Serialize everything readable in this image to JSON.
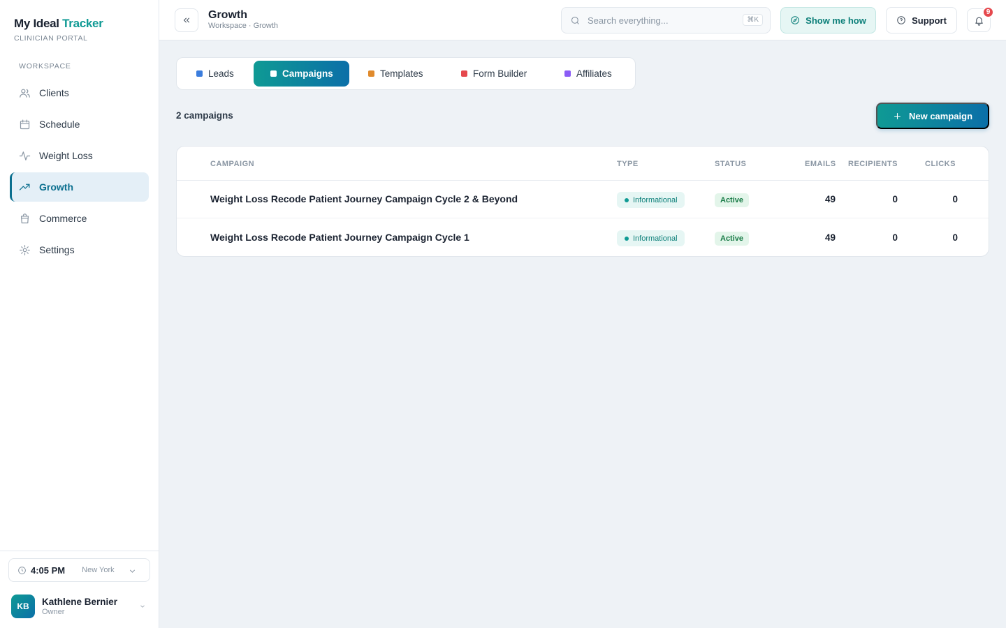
{
  "brand": {
    "name_part1": "My Ideal",
    "name_part2": "Tracker",
    "subtitle": "CLINICIAN PORTAL"
  },
  "sidebar": {
    "section_label": "WORKSPACE",
    "items": [
      {
        "label": "Clients",
        "icon": "users-icon"
      },
      {
        "label": "Schedule",
        "icon": "calendar-icon"
      },
      {
        "label": "Weight Loss",
        "icon": "activity-icon"
      },
      {
        "label": "Growth",
        "icon": "trending-up-icon",
        "active": true
      },
      {
        "label": "Commerce",
        "icon": "shopping-bag-icon"
      },
      {
        "label": "Settings",
        "icon": "gear-icon"
      }
    ],
    "clock": {
      "time": "4:05 PM",
      "city": "New York"
    },
    "user": {
      "initials": "KB",
      "name": "Kathlene Bernier",
      "role": "Owner"
    }
  },
  "header": {
    "title": "Growth",
    "breadcrumb": "Workspace · Growth",
    "search_placeholder": "Search everything...",
    "search_shortcut": "⌘K",
    "show_me_how": "Show me how",
    "support": "Support",
    "notification_count": "9"
  },
  "tabs": [
    {
      "label": "Leads",
      "color": "#3b7ddd"
    },
    {
      "label": "Campaigns",
      "color": "#ffffff",
      "active": true
    },
    {
      "label": "Templates",
      "color": "#e08a2c"
    },
    {
      "label": "Form Builder",
      "color": "#e5484d"
    },
    {
      "label": "Affiliates",
      "color": "#8b5cf6"
    }
  ],
  "campaigns_count": "2 campaigns",
  "new_campaign_label": "New campaign",
  "table": {
    "columns": [
      "CAMPAIGN",
      "TYPE",
      "STATUS",
      "EMAILS",
      "RECIPIENTS",
      "CLICKS"
    ],
    "rows": [
      {
        "name": "Weight Loss Recode Patient Journey Campaign Cycle 2 & Beyond",
        "type": "Informational",
        "status": "Active",
        "emails": "49",
        "recipients": "0",
        "clicks": "0"
      },
      {
        "name": "Weight Loss Recode Patient Journey Campaign Cycle 1",
        "type": "Informational",
        "status": "Active",
        "emails": "49",
        "recipients": "0",
        "clicks": "0"
      }
    ]
  },
  "colors": {
    "accent_teal": "#0f9a94",
    "accent_blue": "#0b6fa8",
    "badge_red": "#e5484d"
  }
}
